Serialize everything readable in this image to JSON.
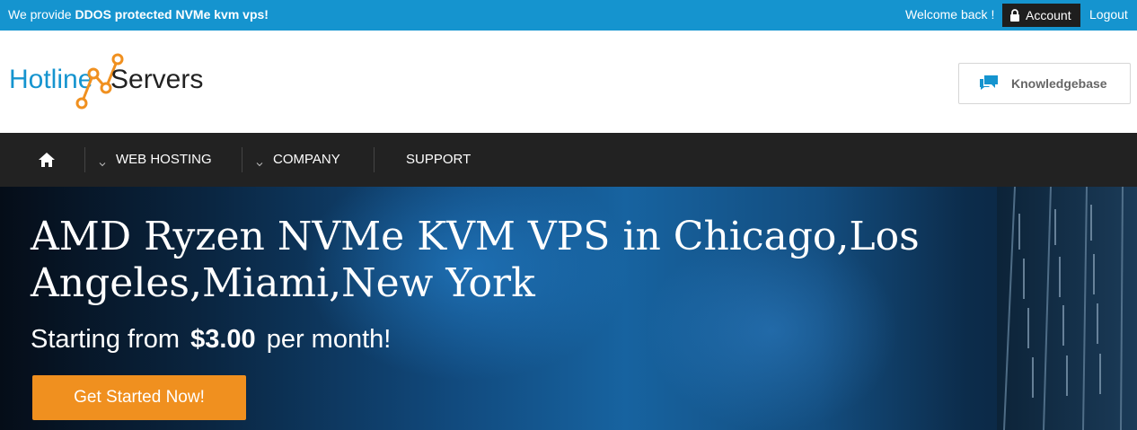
{
  "topbar": {
    "promo_prefix": "We provide ",
    "promo_bold": "DDOS protected NVMe kvm vps!",
    "welcome": "Welcome back !",
    "account_label": "Account",
    "logout_label": "Logout",
    "background_color": "#1594cf"
  },
  "header": {
    "logo_part1": "Hotline",
    "logo_part2": "Servers",
    "knowledgebase_label": "Knowledgebase"
  },
  "nav": {
    "home_icon": "home-icon",
    "items": [
      {
        "label": "WEB HOSTING",
        "has_dropdown": true
      },
      {
        "label": "COMPANY",
        "has_dropdown": true
      },
      {
        "label": "SUPPORT",
        "has_dropdown": false
      }
    ]
  },
  "hero": {
    "title": "AMD Ryzen NVMe KVM VPS in Chicago,Los Angeles,Miami,New York",
    "subtitle_prefix": "Starting from",
    "price": "$3.00",
    "subtitle_suffix": "per month!",
    "cta_label": "Get Started Now!",
    "cta_color": "#f0901f"
  }
}
